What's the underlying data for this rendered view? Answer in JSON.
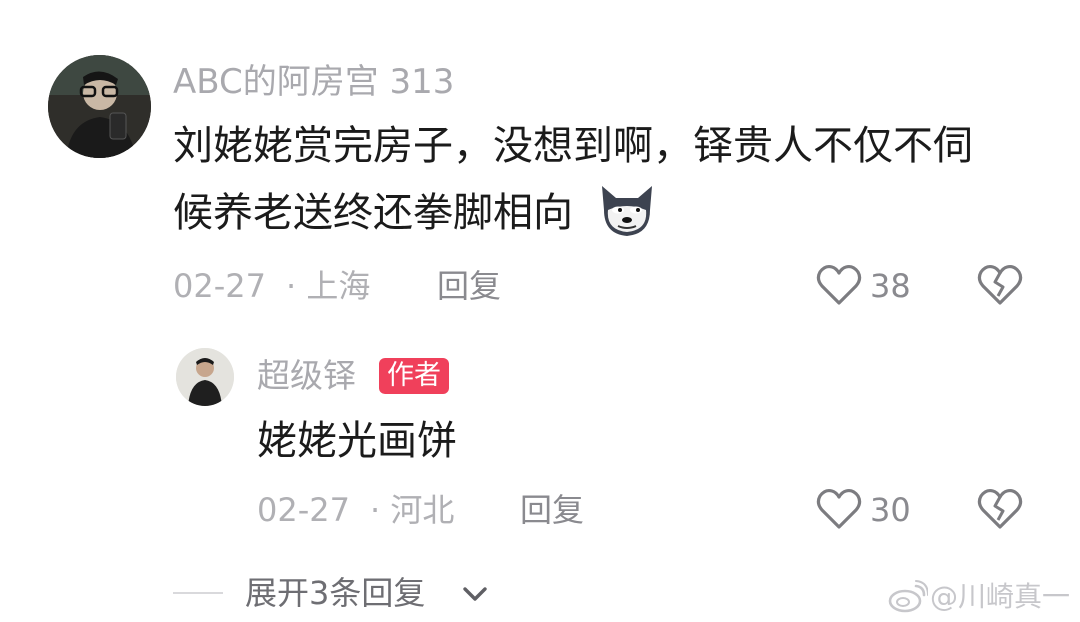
{
  "comment": {
    "username": "ABC的阿房宫 313",
    "text_line1": "刘姥姥赏完房子，没想到啊，铎贵人不仅不伺",
    "text_line2": "候养老送终还拳脚相向",
    "emoji_icon": "doge-emoji-icon",
    "date": "02-27",
    "location": "· 上海",
    "reply_label": "回复",
    "like_count": "38"
  },
  "reply": {
    "username": "超级铎",
    "author_badge": "作者",
    "text": "姥姥光画饼",
    "date": "02-27",
    "location": "· 河北",
    "reply_label": "回复",
    "like_count": "30"
  },
  "expand_replies": {
    "label": "展开3条回复"
  },
  "watermark": {
    "text": "@川崎真一"
  },
  "icons": {
    "like": "heart-outline-icon",
    "dislike": "broken-heart-icon",
    "expand": "chevron-down-icon",
    "weibo": "weibo-logo-icon"
  },
  "colors": {
    "author_badge_bg": "#f0405b",
    "muted_text": "#a9a9ae"
  }
}
